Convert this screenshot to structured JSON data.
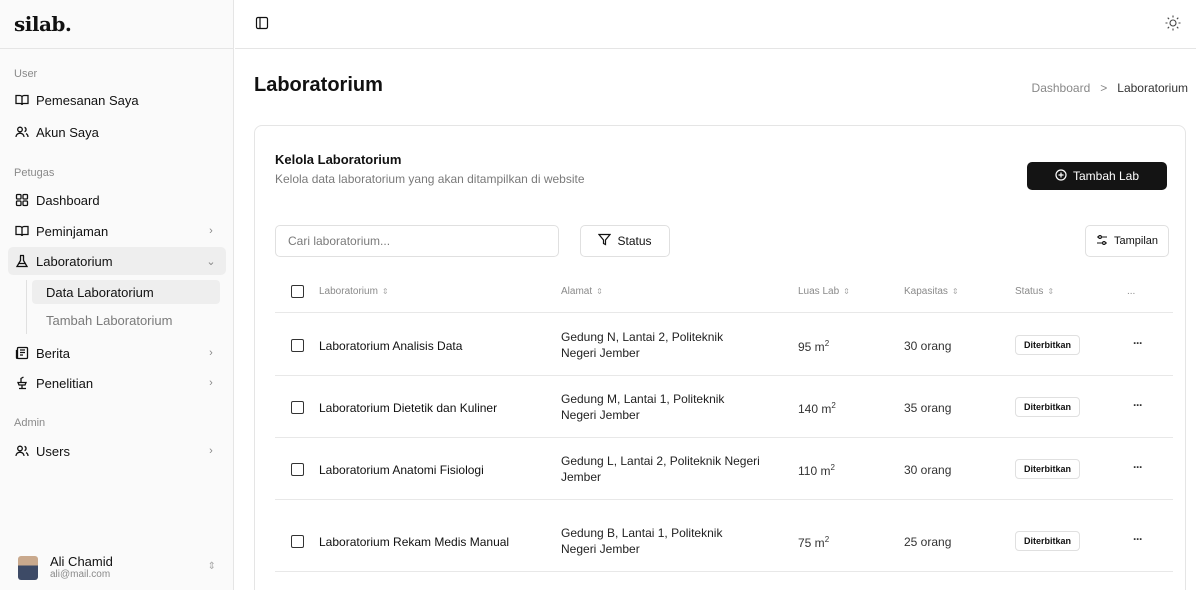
{
  "app": {
    "logo": "silab."
  },
  "sidebar": {
    "sections": [
      {
        "label": "User"
      },
      {
        "label": "Petugas"
      },
      {
        "label": "Admin"
      }
    ],
    "items": [
      {
        "label": "Pemesanan Saya",
        "icon": "book-open-icon"
      },
      {
        "label": "Akun Saya",
        "icon": "users-icon"
      },
      {
        "label": "Dashboard",
        "icon": "grid-icon"
      },
      {
        "label": "Peminjaman",
        "icon": "book-open-icon"
      },
      {
        "label": "Laboratorium",
        "icon": "flask-icon"
      },
      {
        "label": "Berita",
        "icon": "newspaper-icon"
      },
      {
        "label": "Penelitian",
        "icon": "research-icon"
      },
      {
        "label": "Users",
        "icon": "users-icon"
      }
    ],
    "subitems": [
      {
        "label": "Data Laboratorium"
      },
      {
        "label": "Tambah Laboratorium"
      }
    ],
    "user": {
      "name": "Ali Chamid",
      "email": "ali@mail.com"
    }
  },
  "header": {
    "title": "Laboratorium",
    "breadcrumb": [
      "Dashboard",
      ">",
      "Laboratorium"
    ]
  },
  "card": {
    "title": "Kelola Laboratorium",
    "description": "Kelola data laboratorium yang akan ditampilkan di website",
    "add_button": "Tambah Lab",
    "search_placeholder": "Cari laboratorium...",
    "status_filter": "Status",
    "view_button": "Tampilan"
  },
  "table": {
    "columns": [
      "Laboratorium",
      "Alamat",
      "Luas Lab",
      "Kapasitas",
      "Status",
      "..."
    ],
    "rows": [
      {
        "name": "Laboratorium Analisis Data",
        "address": "Gedung N, Lantai 2, Politeknik Negeri Jember",
        "area": "95 m",
        "capacity": "30 orang",
        "status": "Diterbitkan"
      },
      {
        "name": "Laboratorium Dietetik dan Kuliner",
        "address": "Gedung M, Lantai 1, Politeknik Negeri Jember",
        "area": "140 m",
        "capacity": "35 orang",
        "status": "Diterbitkan"
      },
      {
        "name": "Laboratorium Anatomi Fisiologi",
        "address": "Gedung L, Lantai 2, Politeknik Negeri Jember",
        "area": "110 m",
        "capacity": "30 orang",
        "status": "Diterbitkan"
      },
      {
        "name": "Laboratorium Rekam Medis Manual",
        "address": "Gedung B, Lantai 1, Politeknik Negeri Jember",
        "area": "75 m",
        "capacity": "25 orang",
        "status": "Diterbitkan"
      }
    ],
    "area_unit_sup": "2",
    "row_action": "···"
  }
}
